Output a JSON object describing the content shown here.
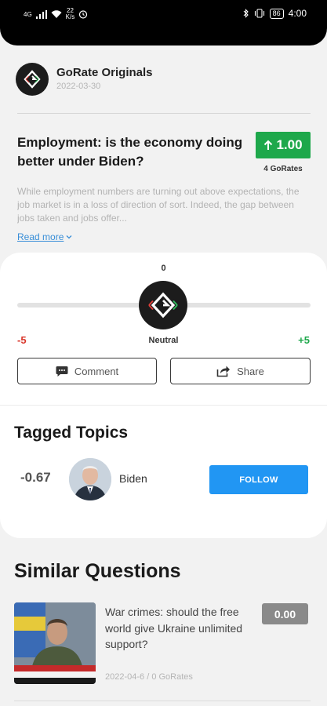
{
  "status_bar": {
    "network_label": "4G",
    "speed_value": "22",
    "speed_unit": "K/s",
    "battery": "86",
    "time": "4:00"
  },
  "post": {
    "author": "GoRate Originals",
    "date": "2022-03-30",
    "title": "Employment: is the economy doing better under Biden?",
    "score": "1.00",
    "score_color": "#1ea84b",
    "gorates": "4 GoRates",
    "description": "While employment numbers are turning out above expectations, the job market is in a loss of direction of sort. Indeed, the gap between jobs taken and jobs offer...",
    "read_more": "Read more"
  },
  "rating": {
    "value": "0",
    "level": 0,
    "min_label": "-5",
    "center_label": "Neutral",
    "max_label": "+5",
    "min_color": "#d9362b",
    "max_color": "#1ea84b"
  },
  "actions": {
    "comment": "Comment",
    "share": "Share"
  },
  "tagged_topics": {
    "heading": "Tagged Topics",
    "items": [
      {
        "score": "-0.67",
        "name": "Biden",
        "follow": "FOLLOW"
      }
    ]
  },
  "similar_questions": {
    "heading": "Similar Questions",
    "items": [
      {
        "title": "War crimes: should the free world give Ukraine unlimited support?",
        "meta": "2022-04-6 / 0 GoRates",
        "score": "0.00"
      }
    ]
  }
}
